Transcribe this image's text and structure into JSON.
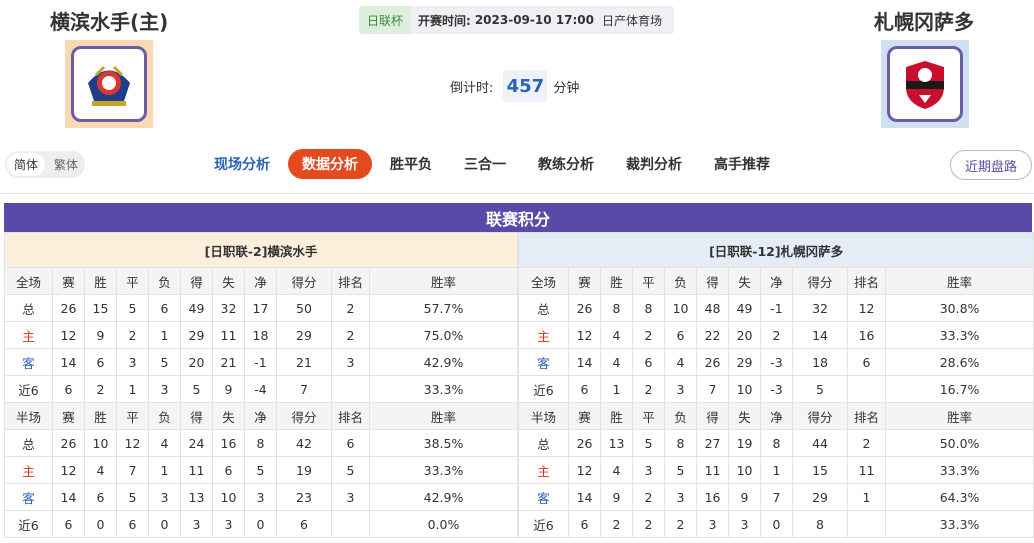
{
  "home": {
    "name": "横滨水手(主)",
    "logo_icon": "yokohama-marinos-crest"
  },
  "away": {
    "name": "札幌冈萨多",
    "logo_icon": "consadole-sapporo-crest"
  },
  "match": {
    "league": "日联杯",
    "kickoff_label": "开赛时间:",
    "kickoff_time": "2023-09-10 17:00",
    "venue": "日产体育场"
  },
  "countdown": {
    "label": "倒计时:",
    "value": "457",
    "unit": "分钟"
  },
  "lang": {
    "simplified": "简体",
    "traditional": "繁体"
  },
  "nav": [
    "现场分析",
    "数据分析",
    "胜平负",
    "三合一",
    "教练分析",
    "裁判分析",
    "高手推荐"
  ],
  "recent_button": "近期盘路",
  "standings": {
    "title": "联赛积分",
    "left_team_header": "[日职联-2]横滨水手",
    "right_team_header": "[日职联-12]札幌冈萨多",
    "full_headers": [
      "全场",
      "赛",
      "胜",
      "平",
      "负",
      "得",
      "失",
      "净",
      "得分",
      "排名",
      "胜率"
    ],
    "half_headers": [
      "半场",
      "赛",
      "胜",
      "平",
      "负",
      "得",
      "失",
      "净",
      "得分",
      "排名",
      "胜率"
    ],
    "left_full": [
      [
        "总",
        "26",
        "15",
        "5",
        "6",
        "49",
        "32",
        "17",
        "50",
        "2",
        "57.7%"
      ],
      [
        "主",
        "12",
        "9",
        "2",
        "1",
        "29",
        "11",
        "18",
        "29",
        "2",
        "75.0%"
      ],
      [
        "客",
        "14",
        "6",
        "3",
        "5",
        "20",
        "21",
        "-1",
        "21",
        "3",
        "42.9%"
      ],
      [
        "近6",
        "6",
        "2",
        "1",
        "3",
        "5",
        "9",
        "-4",
        "7",
        "",
        "33.3%"
      ]
    ],
    "left_half": [
      [
        "总",
        "26",
        "10",
        "12",
        "4",
        "24",
        "16",
        "8",
        "42",
        "6",
        "38.5%"
      ],
      [
        "主",
        "12",
        "4",
        "7",
        "1",
        "11",
        "6",
        "5",
        "19",
        "5",
        "33.3%"
      ],
      [
        "客",
        "14",
        "6",
        "5",
        "3",
        "13",
        "10",
        "3",
        "23",
        "3",
        "42.9%"
      ],
      [
        "近6",
        "6",
        "0",
        "6",
        "0",
        "3",
        "3",
        "0",
        "6",
        "",
        "0.0%"
      ]
    ],
    "right_full": [
      [
        "总",
        "26",
        "8",
        "8",
        "10",
        "48",
        "49",
        "-1",
        "32",
        "12",
        "30.8%"
      ],
      [
        "主",
        "12",
        "4",
        "2",
        "6",
        "22",
        "20",
        "2",
        "14",
        "16",
        "33.3%"
      ],
      [
        "客",
        "14",
        "4",
        "6",
        "4",
        "26",
        "29",
        "-3",
        "18",
        "6",
        "28.6%"
      ],
      [
        "近6",
        "6",
        "1",
        "2",
        "3",
        "7",
        "10",
        "-3",
        "5",
        "",
        "16.7%"
      ]
    ],
    "right_half": [
      [
        "总",
        "26",
        "13",
        "5",
        "8",
        "27",
        "19",
        "8",
        "44",
        "2",
        "50.0%"
      ],
      [
        "主",
        "12",
        "4",
        "3",
        "5",
        "11",
        "10",
        "1",
        "15",
        "11",
        "33.3%"
      ],
      [
        "客",
        "14",
        "9",
        "2",
        "3",
        "16",
        "9",
        "7",
        "29",
        "1",
        "64.3%"
      ],
      [
        "近6",
        "6",
        "2",
        "2",
        "2",
        "3",
        "3",
        "0",
        "8",
        "",
        "33.3%"
      ]
    ]
  },
  "colors": {
    "accent_purple": "#5a4aa8",
    "active_tab": "#e34b1f",
    "home_red": "#e0301e",
    "away_blue": "#2a62b6"
  }
}
